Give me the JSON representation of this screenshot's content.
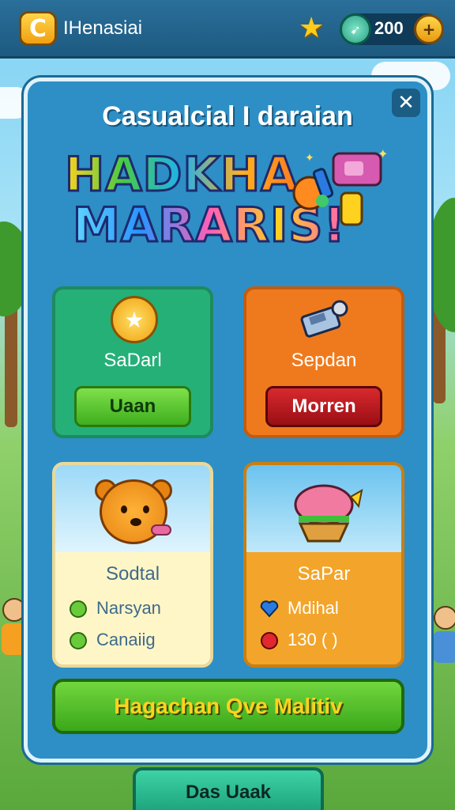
{
  "topbar": {
    "logo_letter": "C",
    "title": "IHenasiai",
    "gem_count": "200",
    "add_symbol": "+"
  },
  "modal": {
    "title": "Casualcial I daraian",
    "logo_line1": "HADKHA",
    "logo_line2": "MARARIS!",
    "close_symbol": "✕"
  },
  "cards": {
    "green": {
      "label": "SaDarl",
      "button": "Uaan"
    },
    "orange": {
      "label": "Sepdan",
      "button": "Morren"
    },
    "bear": {
      "label": "Sodtal",
      "stat1": "Narsyan",
      "stat2": "Canaiig"
    },
    "food": {
      "label": "SaPar",
      "stat1": "Mdihal",
      "stat2": "130 ( )"
    }
  },
  "cta": {
    "label": "Hagachan Qve Malitiv"
  },
  "bottom": {
    "label": "Das Uaak"
  },
  "colors": {
    "modal_bg": "#2d8fc6",
    "green_card": "#25b078",
    "orange_card": "#ef7a1e",
    "cta": "#3aa81a"
  },
  "icons": [
    "logo-c-icon",
    "star-icon",
    "gem-icon",
    "add-coin-icon",
    "close-icon",
    "coin-icon",
    "pager-icon",
    "bear-icon",
    "burger-icon",
    "apple-icon",
    "heart-icon"
  ]
}
